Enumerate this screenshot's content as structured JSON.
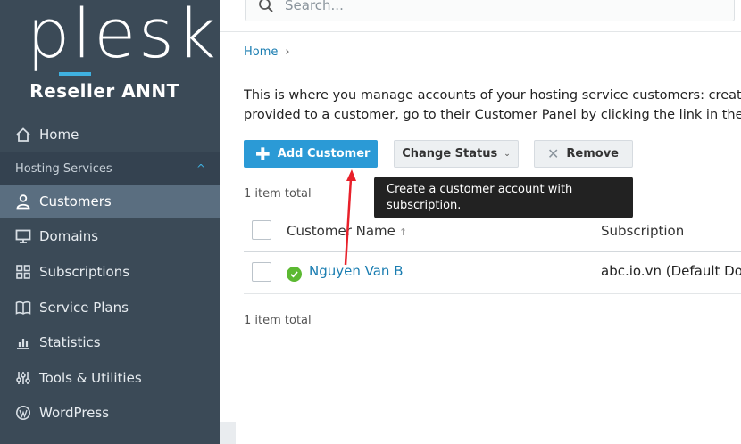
{
  "sidebar": {
    "logo": "plesk",
    "subtitle": "Reseller ANNT",
    "home": "Home",
    "section": "Hosting Services",
    "items": [
      {
        "label": "Customers",
        "icon": "user-icon"
      },
      {
        "label": "Domains",
        "icon": "monitor-icon"
      },
      {
        "label": "Subscriptions",
        "icon": "grid-icon"
      },
      {
        "label": "Service Plans",
        "icon": "book-icon"
      },
      {
        "label": "Statistics",
        "icon": "bar-chart-icon"
      },
      {
        "label": "Tools & Utilities",
        "icon": "sliders-icon"
      },
      {
        "label": "WordPress",
        "icon": "wordpress-icon"
      }
    ],
    "active_item": "Customers"
  },
  "search": {
    "placeholder": "Search..."
  },
  "breadcrumb": {
    "home": "Home",
    "separator": "›"
  },
  "description": {
    "line1": "This is where you manage accounts of your hosting service customers: create",
    "line2": "provided to a customer, go to their Customer Panel by clicking the link in the r"
  },
  "toolbar": {
    "add_label": "Add Customer",
    "status_label": "Change Status",
    "remove_label": "Remove"
  },
  "tooltip": {
    "text": "Create a customer account with subscription."
  },
  "table": {
    "total_top": "1 item total",
    "total_bottom": "1 item total",
    "columns": {
      "name": "Customer Name",
      "sort": "↑",
      "subscription": "Subscription"
    },
    "rows": [
      {
        "name": "Nguyen Van B",
        "status": "active",
        "subscription": "abc.io.vn (Default Dom"
      }
    ]
  },
  "colors": {
    "sidebar": "#3b4a57",
    "accent": "#2b9ad6",
    "link": "#1a7db1",
    "status_ok": "#5cb932",
    "annotation": "#e8202a"
  }
}
